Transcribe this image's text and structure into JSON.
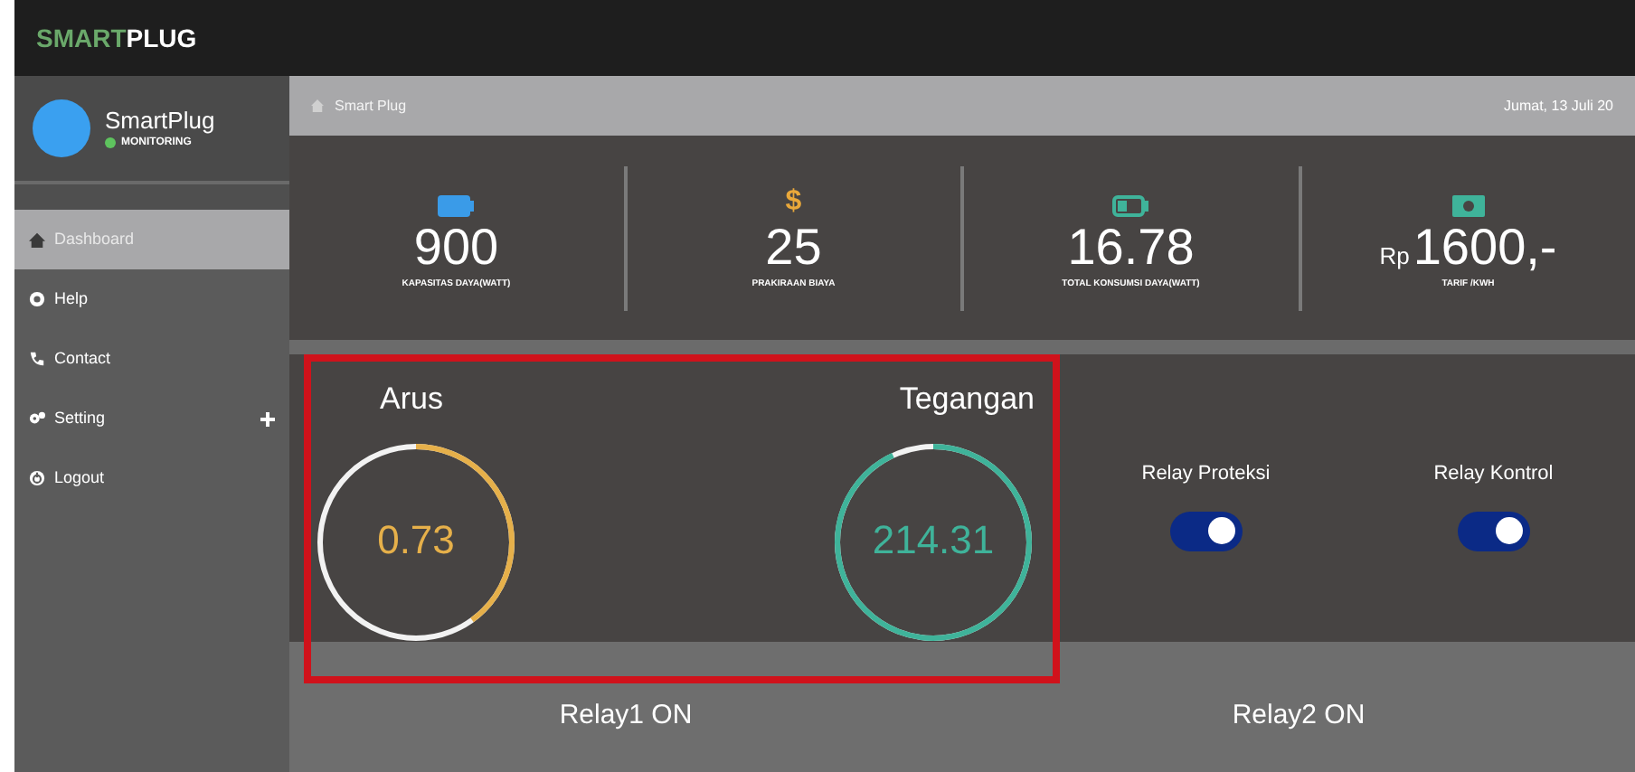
{
  "brand": {
    "first": "SMART",
    "second": "PLUG"
  },
  "profile": {
    "name": "SmartPlug",
    "status": "MONITORING",
    "online": true
  },
  "sidebar": {
    "items": [
      {
        "label": "Dashboard",
        "selected": true
      },
      {
        "label": "Help",
        "selected": false
      },
      {
        "label": "Contact",
        "selected": false
      },
      {
        "label": "Setting",
        "selected": false,
        "expandable": true
      },
      {
        "label": "Logout",
        "selected": false
      }
    ]
  },
  "breadcrumb": {
    "page": "Smart Plug",
    "date": "Jumat, 13 Juli 20"
  },
  "stats": [
    {
      "value": "900",
      "label": "KAPASITAS DAYA(WATT)"
    },
    {
      "symbol": "$",
      "value": "25",
      "label": "PRAKIRAAN BIAYA"
    },
    {
      "value": "16.78",
      "label": "TOTAL KONSUMSI DAYA(WATT)"
    },
    {
      "prefix": "Rp",
      "value": "1600,-",
      "label": "TARIF /KWH"
    }
  ],
  "gauges": [
    {
      "label": "Arus",
      "value": "0.73",
      "level": 0.4,
      "color": "#e6b04a"
    },
    {
      "label": "Tegangan",
      "value": "214.31",
      "level": 0.93,
      "color": "#3fb39a"
    }
  ],
  "relays": [
    {
      "label": "Relay Proteksi",
      "on": true,
      "status": "Relay1 ON"
    },
    {
      "label": "Relay Kontrol",
      "on": true,
      "status": "Relay2 ON"
    }
  ]
}
